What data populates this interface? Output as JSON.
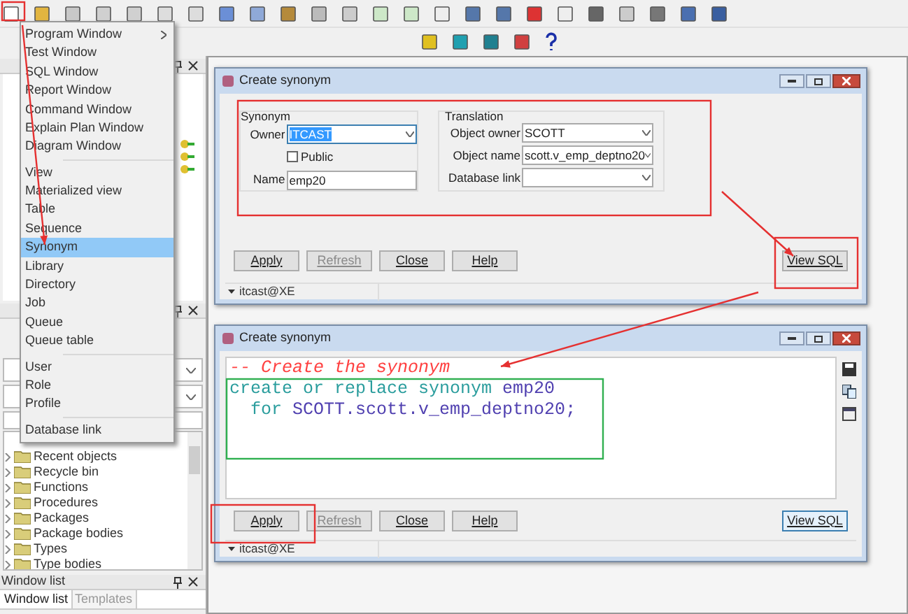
{
  "menu": {
    "groups": [
      [
        {
          "label": "Program Window",
          "submenu": true,
          "selected": false
        },
        {
          "label": "Test Window",
          "submenu": false,
          "selected": false
        },
        {
          "label": "SQL Window",
          "submenu": false,
          "selected": false
        },
        {
          "label": "Report Window",
          "submenu": false,
          "selected": false
        },
        {
          "label": "Command Window",
          "submenu": false,
          "selected": false
        },
        {
          "label": "Explain Plan Window",
          "submenu": false,
          "selected": false
        },
        {
          "label": "Diagram Window",
          "submenu": false,
          "selected": false
        }
      ],
      [
        {
          "label": "View",
          "submenu": false,
          "selected": false
        },
        {
          "label": "Materialized view",
          "submenu": false,
          "selected": false
        },
        {
          "label": "Table",
          "submenu": false,
          "selected": false
        },
        {
          "label": "Sequence",
          "submenu": false,
          "selected": false
        },
        {
          "label": "Synonym",
          "submenu": false,
          "selected": true
        },
        {
          "label": "Library",
          "submenu": false,
          "selected": false
        },
        {
          "label": "Directory",
          "submenu": false,
          "selected": false
        },
        {
          "label": "Job",
          "submenu": false,
          "selected": false
        },
        {
          "label": "Queue",
          "submenu": false,
          "selected": false
        },
        {
          "label": "Queue table",
          "submenu": false,
          "selected": false
        }
      ],
      [
        {
          "label": "User",
          "submenu": false,
          "selected": false
        },
        {
          "label": "Role",
          "submenu": false,
          "selected": false
        },
        {
          "label": "Profile",
          "submenu": false,
          "selected": false
        }
      ],
      [
        {
          "label": "Database link",
          "submenu": false,
          "selected": false
        }
      ]
    ]
  },
  "browser": {
    "tree": [
      "Recent objects",
      "Recycle bin",
      "Functions",
      "Procedures",
      "Packages",
      "Package bodies",
      "Types",
      "Type bodies"
    ]
  },
  "window_list": {
    "title": "Window list",
    "tabs": [
      {
        "label": "Window list",
        "selected": true
      },
      {
        "label": "Templates",
        "selected": false
      }
    ]
  },
  "windows": [
    {
      "kind": "form",
      "title": "Create synonym",
      "synonym": {
        "title": "Synonym",
        "owner_label": "Owner",
        "owner": "ITCAST",
        "owner_highlighted": true,
        "public_label": "Public",
        "public_checked": false,
        "name_label": "Name",
        "name": "emp20"
      },
      "translation": {
        "title": "Translation",
        "fields": [
          {
            "label": "Object owner",
            "value": "SCOTT"
          },
          {
            "label": "Object name",
            "value": "scott.v_emp_deptno20"
          },
          {
            "label": "Database link"
          }
        ]
      },
      "buttons": [
        {
          "label": "Apply",
          "disabled": false,
          "default": false
        },
        {
          "label": "Refresh",
          "disabled": true,
          "default": false
        },
        {
          "label": "Close",
          "disabled": false,
          "default": false
        },
        {
          "label": "Help",
          "disabled": false,
          "default": false
        }
      ],
      "view_sql": {
        "label": "View SQL",
        "default": false
      },
      "status": "itcast@XE"
    },
    {
      "kind": "sql",
      "title": "Create synonym",
      "code": [
        {
          "indented": false,
          "tokens": [
            {
              "kind": "comment",
              "text": "-- Create the synonym"
            }
          ]
        },
        {
          "indented": false,
          "tokens": [
            {
              "kind": "keyword",
              "text": "create or replace synonym"
            },
            {
              "kind": "identifier",
              "text": "emp20"
            }
          ]
        },
        {
          "indented": true,
          "tokens": [
            {
              "kind": "keyword",
              "text": "for"
            },
            {
              "kind": "identifier",
              "text": "SCOTT.scott.v_emp_deptno20;"
            }
          ]
        }
      ],
      "buttons": [
        {
          "label": "Apply",
          "disabled": false,
          "default": false
        },
        {
          "label": "Refresh",
          "disabled": true,
          "default": false
        },
        {
          "label": "Close",
          "disabled": false,
          "default": false
        },
        {
          "label": "Help",
          "disabled": false,
          "default": false
        }
      ],
      "view_sql": {
        "label": "View SQL",
        "default": true
      },
      "status": "itcast@XE"
    }
  ]
}
